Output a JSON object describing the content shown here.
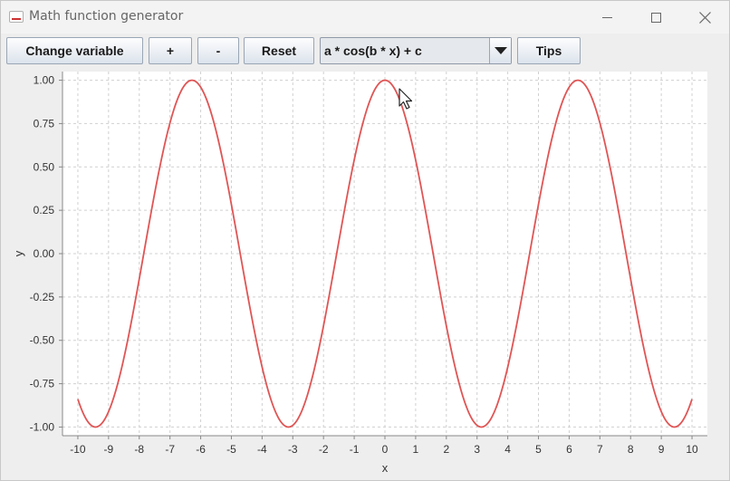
{
  "window": {
    "title": "Math function generator"
  },
  "toolbar": {
    "change_variable_label": "Change variable",
    "plus_label": "+",
    "minus_label": "-",
    "reset_label": "Reset",
    "function_select_value": "a * cos(b * x) + c",
    "tips_label": "Tips"
  },
  "icons": {
    "minimize": "minimize-icon",
    "maximize": "maximize-icon",
    "close": "close-icon",
    "dropdown": "chevron-down-icon",
    "app": "app-icon",
    "cursor": "mouse-cursor-icon"
  },
  "colors": {
    "series": "#e05555",
    "grid": "#d0d0d0",
    "plot_background": "#ffffff"
  },
  "chart_data": {
    "type": "line",
    "title": "",
    "xlabel": "x",
    "ylabel": "y",
    "xlim": [
      -10.5,
      10.5
    ],
    "ylim": [
      -1.05,
      1.05
    ],
    "x_ticks": [
      -10,
      -9,
      -8,
      -7,
      -6,
      -5,
      -4,
      -3,
      -2,
      -1,
      0,
      1,
      2,
      3,
      4,
      5,
      6,
      7,
      8,
      9,
      10
    ],
    "y_ticks": [
      "1.00",
      "0.75",
      "0.50",
      "0.25",
      "0.00",
      "-0.25",
      "-0.50",
      "-0.75",
      "-1.00"
    ],
    "grid": true,
    "legend": "none",
    "function": {
      "expression": "a * cos(b * x) + c",
      "a": 1,
      "b": 1,
      "c": 0,
      "x_range": [
        -10,
        10
      ]
    },
    "series": [
      {
        "x": [
          -10,
          -9.5,
          -9,
          -8,
          -7,
          -6.28,
          -6,
          -5,
          -4,
          -3.14,
          -3,
          -2,
          -1,
          0,
          1,
          2,
          3,
          3.14,
          4,
          5,
          6,
          6.28,
          7,
          8,
          9,
          9.5,
          10
        ],
        "y": [
          -0.84,
          -1.0,
          -0.91,
          -0.15,
          0.75,
          1.0,
          0.96,
          0.28,
          -0.65,
          -1.0,
          -0.99,
          -0.42,
          0.54,
          1.0,
          0.54,
          -0.42,
          -0.99,
          -1.0,
          -0.65,
          0.28,
          0.96,
          1.0,
          0.75,
          -0.15,
          -0.91,
          -1.0,
          -0.84
        ]
      }
    ]
  }
}
